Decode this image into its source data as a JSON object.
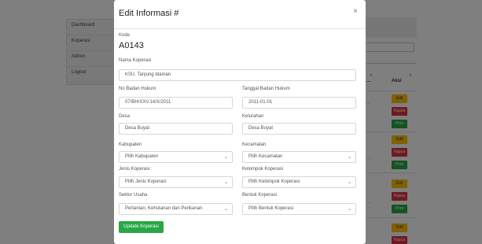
{
  "sidebar": {
    "items": [
      {
        "label": "Dashboard"
      },
      {
        "label": "Koperasi"
      },
      {
        "label": "Admin"
      },
      {
        "label": "Logout"
      }
    ]
  },
  "table": {
    "headers": [
      {
        "label": "..."
      },
      {
        "label": "Aksi"
      }
    ],
    "cells": [
      "...",
      "...",
      "..."
    ],
    "action_buttons": {
      "edit": "Edit",
      "hapus": "Hapus",
      "print": "Print"
    }
  },
  "modal": {
    "title": "Edit Informasi #",
    "close": "×",
    "kode_label": "Kode",
    "kode_value": "A0143",
    "nama_label": "Nama Koperasi",
    "nama_value": "KSU. Tanjung Idaman",
    "no_badan_hukum_label": "No Badan Hukum",
    "no_badan_hukum_value": "07/BH/XXV.14/X/2011",
    "tanggal_badan_hukum_label": "Tanggal Badan Hukum",
    "tanggal_badan_hukum_value": "2011-01-01",
    "desa_label": "Desa",
    "desa_value": "Desa Buyat",
    "kelurahan_label": "Kelurahan",
    "kelurahan_value": "Desa Buyat",
    "kabupaten_label": "Kabupaten",
    "kabupaten_value": "Pilih Kabupaten",
    "kecamatan_label": "Kecamatan",
    "kecamatan_value": "Pilih Kecamatan",
    "jenis_label": "Jenis Koperasi :",
    "jenis_value": "Pilih Jenis Koperasi",
    "kelompok_label": "Kelompok Koperasi",
    "kelompok_value": "Pilih Kelompok Koperasi",
    "sektor_label": "Sektor Usaha",
    "sektor_value": "Pertanian, Kehutanan dan Perikanan",
    "bentuk_label": "Bentuk Koperasi",
    "bentuk_value": "Pilih Bentuk Koperasi",
    "update_button": "Update Koperasi"
  },
  "icons": {
    "chevron": "chevron-down-icon"
  }
}
